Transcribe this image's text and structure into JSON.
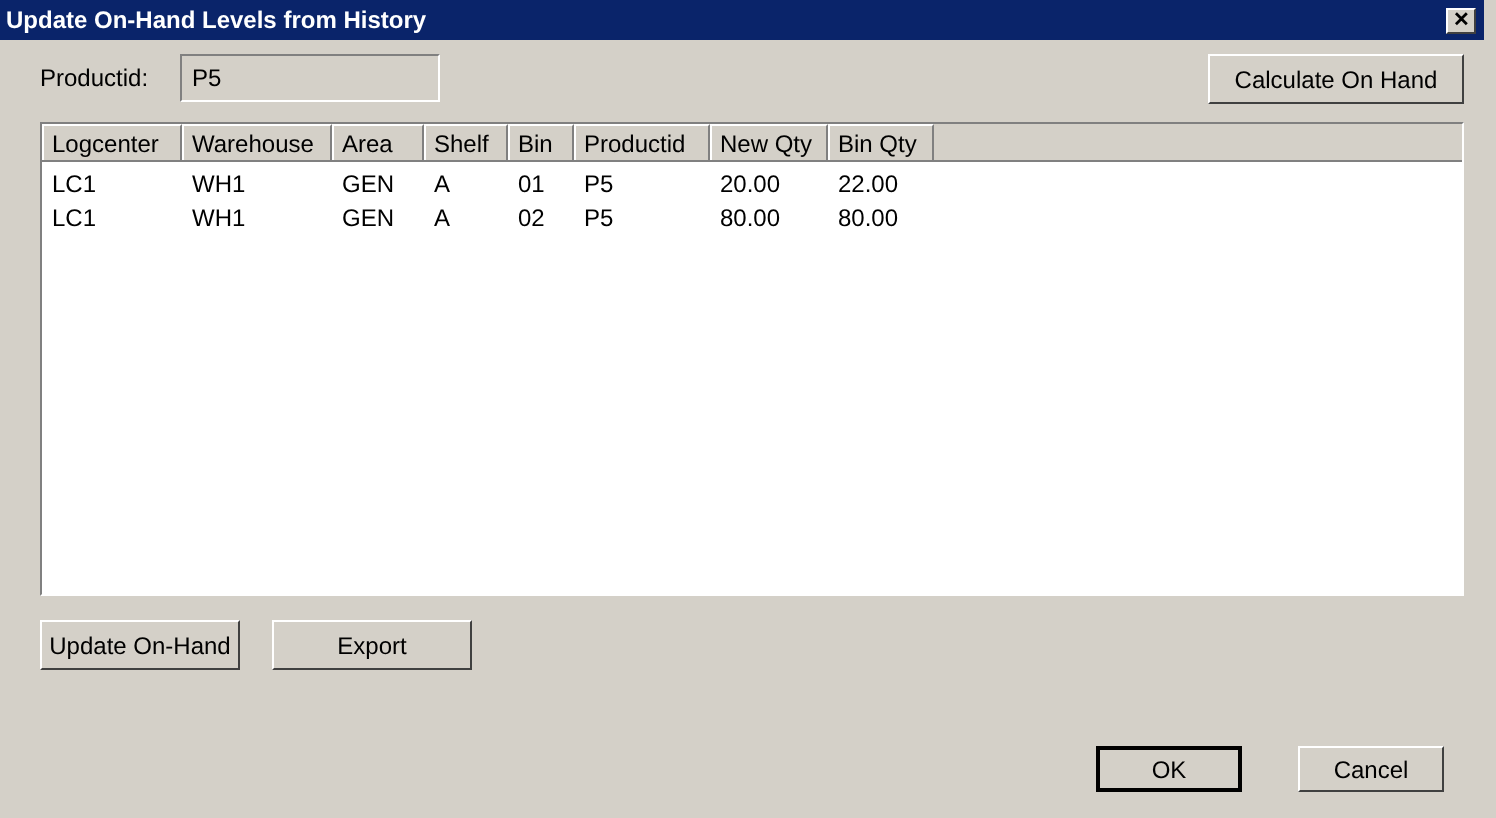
{
  "window": {
    "title": "Update On-Hand Levels from History",
    "close": "✕"
  },
  "productid": {
    "label": "Productid:",
    "value": "P5"
  },
  "calculate_button": "Calculate On Hand",
  "table": {
    "columns": [
      "Logcenter",
      "Warehouse",
      "Area",
      "Shelf",
      "Bin",
      "Productid",
      "New Qty",
      "Bin Qty"
    ],
    "rows": [
      [
        "LC1",
        "WH1",
        "GEN",
        "A",
        "01",
        "P5",
        "20.00",
        "22.00"
      ],
      [
        "LC1",
        "WH1",
        "GEN",
        "A",
        "02",
        "P5",
        "80.00",
        "80.00"
      ]
    ]
  },
  "action_buttons": [
    "Update On-Hand",
    "Export"
  ],
  "dialog_buttons": [
    {
      "label": "OK",
      "default": true
    },
    {
      "label": "Cancel",
      "default": false
    }
  ]
}
